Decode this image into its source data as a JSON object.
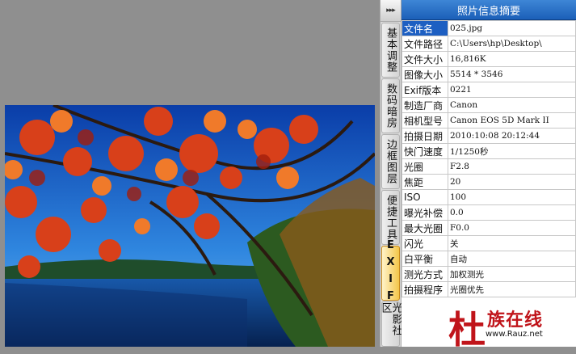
{
  "panel": {
    "title": "照片信息摘要",
    "rows": [
      {
        "key": "文件名",
        "value": "025.jpg"
      },
      {
        "key": "文件路径",
        "value": "C:\\Users\\hp\\Desktop\\"
      },
      {
        "key": "文件大小",
        "value": "16,816K"
      },
      {
        "key": "图像大小",
        "value": "5514 * 3546"
      },
      {
        "key": "Exif版本",
        "value": "0221"
      },
      {
        "key": "制造厂商",
        "value": "Canon"
      },
      {
        "key": "相机型号",
        "value": "Canon EOS 5D Mark II"
      },
      {
        "key": "拍摄日期",
        "value": "2010:10:08 20:12:44"
      },
      {
        "key": "快门速度",
        "value": "1/1250秒"
      },
      {
        "key": "光圈",
        "value": "F2.8"
      },
      {
        "key": "焦距",
        "value": "20"
      },
      {
        "key": "ISO",
        "value": "100"
      },
      {
        "key": "曝光补偿",
        "value": "0.0"
      },
      {
        "key": "最大光圈",
        "value": "F0.0"
      },
      {
        "key": "闪光",
        "value": "关"
      },
      {
        "key": "白平衡",
        "value": "自动"
      },
      {
        "key": "测光方式",
        "value": "加权测光"
      },
      {
        "key": "拍摄程序",
        "value": "光圈优先"
      }
    ]
  },
  "tabs": {
    "toggle": "▸▸▸",
    "items": [
      "基本调整",
      "数码暗房",
      "边框图层",
      "便捷工具",
      "EXIF",
      "光影社区"
    ]
  },
  "watermark": {
    "char": "杜",
    "name": "族在线",
    "url": "www.Rauz.net"
  },
  "colors": {
    "accent": "#1d5fc2",
    "active_tab": "#f3c64a",
    "canvas": "#8f8f8f"
  }
}
